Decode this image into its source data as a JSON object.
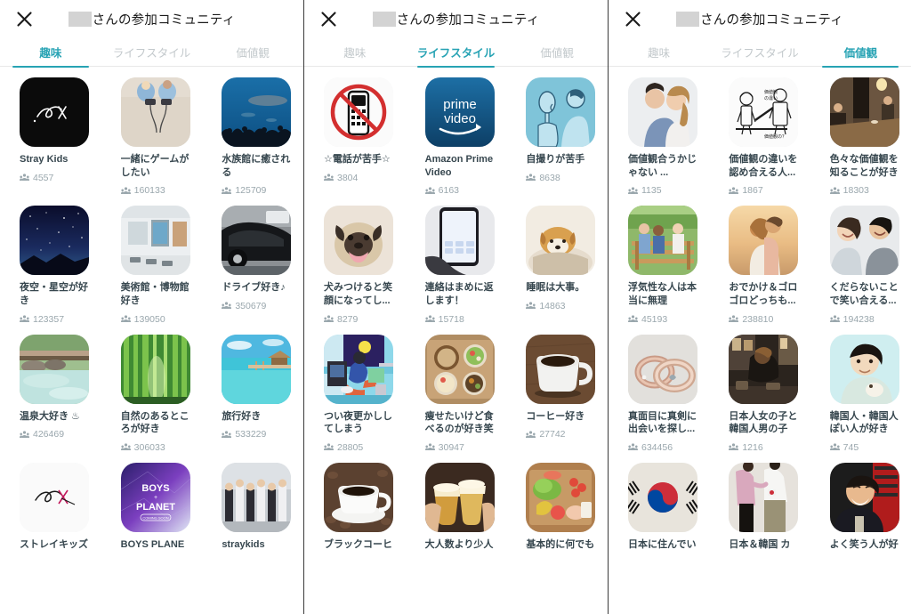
{
  "header": {
    "close_icon": "close-icon",
    "title_suffix": "さんの参加コミュニティ",
    "name_redacted": ""
  },
  "tabs": [
    {
      "id": "hobby",
      "label": "趣味"
    },
    {
      "id": "lifestyle",
      "label": "ライフスタイル"
    },
    {
      "id": "values",
      "label": "価値観"
    }
  ],
  "panels": [
    {
      "active_tab": 0,
      "cards": [
        {
          "title": "Stray Kids",
          "count": "4557",
          "art": "straykids-black"
        },
        {
          "title": "一緒にゲームがしたい",
          "count": "160133",
          "art": "gaming-sand"
        },
        {
          "title": "水族館に癒される",
          "count": "125709",
          "art": "aquarium"
        },
        {
          "title": "夜空・星空が好き",
          "count": "123357",
          "art": "night-sky"
        },
        {
          "title": "美術館・博物館好き",
          "count": "139050",
          "art": "museum"
        },
        {
          "title": "ドライブ好き♪",
          "count": "350679",
          "art": "car"
        },
        {
          "title": "温泉大好き ♨",
          "count": "426469",
          "art": "onsen"
        },
        {
          "title": "自然のあるところが好き",
          "count": "306033",
          "art": "bamboo"
        },
        {
          "title": "旅行好き",
          "count": "533229",
          "art": "resort"
        },
        {
          "title": "ストレイキッズ",
          "count": "",
          "art": "straykids-white"
        },
        {
          "title": "BOYS PLANE",
          "count": "",
          "art": "boys-planet"
        },
        {
          "title": "straykids",
          "count": "",
          "art": "group-photo"
        }
      ]
    },
    {
      "active_tab": 1,
      "cards": [
        {
          "title": "☆電話が苦手☆",
          "count": "3804",
          "art": "no-phone"
        },
        {
          "title": "Amazon Prime Video",
          "count": "6163",
          "art": "prime-video"
        },
        {
          "title": "自撮りが苦手",
          "count": "8638",
          "art": "selfie-illust"
        },
        {
          "title": "犬みつけると笑顔になってし...",
          "count": "8279",
          "art": "pug"
        },
        {
          "title": "連絡はまめに返します！",
          "count": "15718",
          "art": "phone-hand"
        },
        {
          "title": "睡眠は大事。",
          "count": "14863",
          "art": "sleeping-dog"
        },
        {
          "title": "つい夜更かししてしまう",
          "count": "28805",
          "art": "night-owl"
        },
        {
          "title": "痩せたいけど食べるのが好き笑",
          "count": "30947",
          "art": "meal-set"
        },
        {
          "title": "コーヒー好き",
          "count": "27742",
          "art": "coffee-mug"
        },
        {
          "title": "ブラックコーヒ",
          "count": "",
          "art": "black-coffee"
        },
        {
          "title": "大人数より少人",
          "count": "",
          "art": "beer-cheers"
        },
        {
          "title": "基本的に何でも",
          "count": "",
          "art": "vegetables"
        }
      ]
    },
    {
      "active_tab": 2,
      "cards": [
        {
          "title": "価値観合うかじゃない ...",
          "count": "1135",
          "art": "couple-embrace"
        },
        {
          "title": "価値観の違いを認め合える人...",
          "count": "1867",
          "art": "sketch-values"
        },
        {
          "title": "色々な価値観を知ることが好き",
          "count": "18303",
          "art": "cafe-interior"
        },
        {
          "title": "浮気性な人は本当に無理",
          "count": "45193",
          "art": "bench-trio"
        },
        {
          "title": "おでかけ＆ゴロゴロどっちも...",
          "count": "238810",
          "art": "beach-couple"
        },
        {
          "title": "くだらないことで笑い合える...",
          "count": "194238",
          "art": "smiling-pair"
        },
        {
          "title": "真面目に真剣に出会いを探し...",
          "count": "634456",
          "art": "rings"
        },
        {
          "title": "日本人女の子と韓国人男の子",
          "count": "1216",
          "art": "bar-scene"
        },
        {
          "title": "韓国人・韓国人ぽい人が好き",
          "count": "745",
          "art": "korean-man"
        },
        {
          "title": "日本に住んでい",
          "count": "",
          "art": "korea-flag"
        },
        {
          "title": "日本＆韓国 カ",
          "count": "",
          "art": "couple-walk"
        },
        {
          "title": "よく笑う人が好",
          "count": "",
          "art": "laughing-man"
        }
      ]
    }
  ],
  "colors": {
    "accent": "#27a3b4",
    "title_text": "#37474f",
    "count_text": "#9aa7ad",
    "inactive_tab": "#c3c9cc"
  }
}
